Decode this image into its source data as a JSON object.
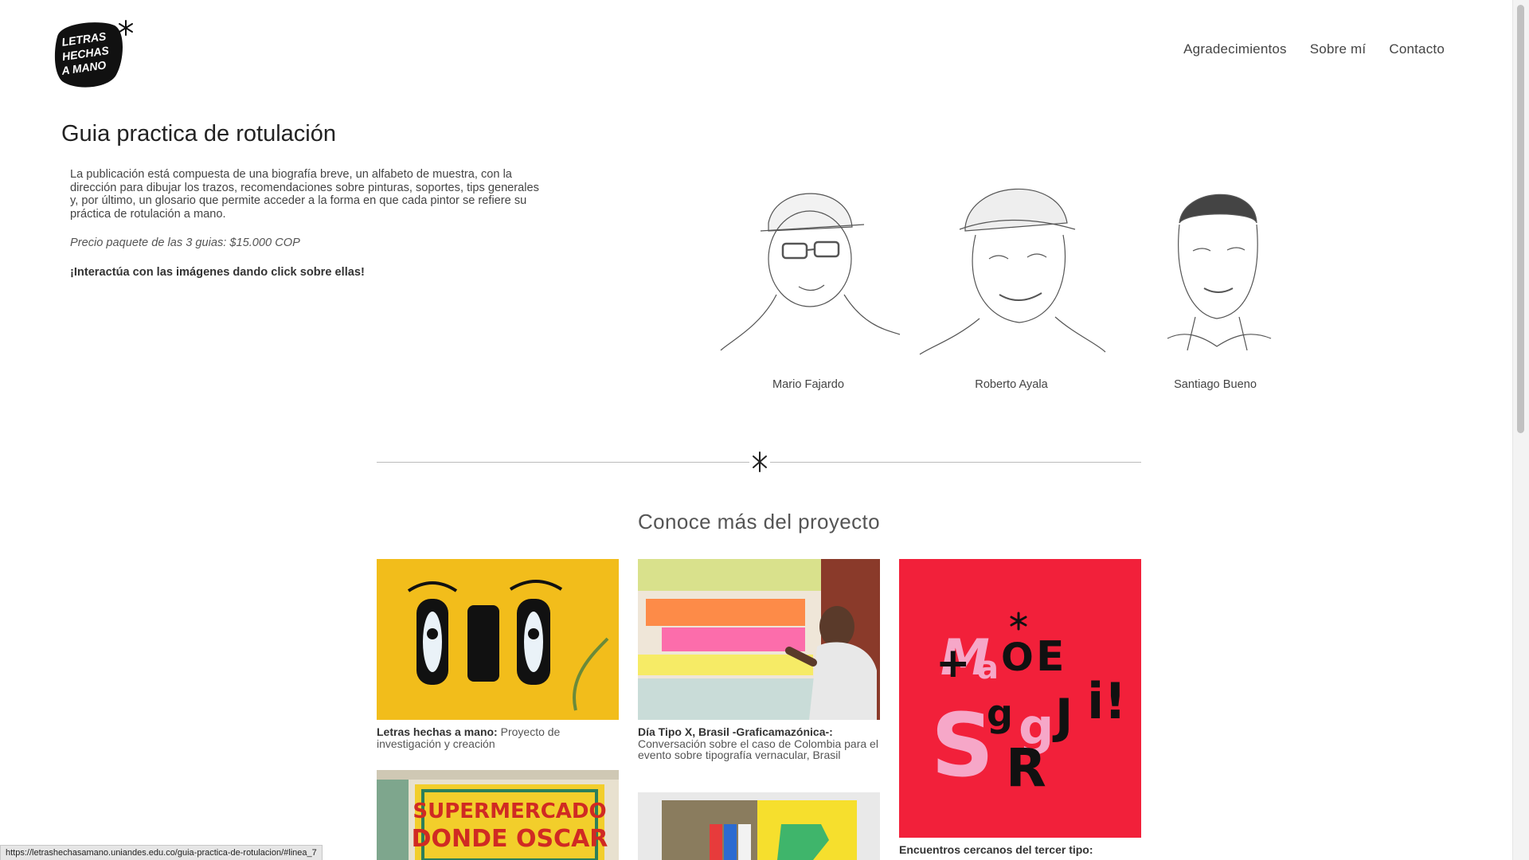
{
  "header": {
    "logo_lines": [
      "LETRAS",
      "HECHAS",
      "A MANO"
    ],
    "nav": [
      "Agradecimientos",
      "Sobre mí",
      "Contacto"
    ]
  },
  "page": {
    "title": "Guia practica de rotulación",
    "description": "La publicación está compuesta de una biografía breve, un alfabeto de muestra, con la dirección para dibujar los trazos, recomendaciones sobre pinturas, soportes, tips generales y, por último, un glosario que permite acceder a la forma en que cada pintor se refiere su práctica de rotulación a mano.",
    "price": "Precio paquete de las 3 guias: $15.000 COP",
    "cta": "¡Interactúa con las imágenes dando click sobre ellas!"
  },
  "portraits": [
    {
      "name": "Mario Fajardo",
      "icon": "portrait-sketch-icon"
    },
    {
      "name": "Roberto Ayala",
      "icon": "portrait-sketch-icon"
    },
    {
      "name": "Santiago Bueno",
      "icon": "portrait-sketch-icon"
    }
  ],
  "section": {
    "title": "Conoce más del proyecto"
  },
  "cards": [
    {
      "title": "Letras hechas a mano:",
      "text": " Proyecto de investigación y creación",
      "image": "ojo-sign"
    },
    {
      "title": "Día Tipo X, Brasil -Graficamazónica-:",
      "text": " Conversación sobre el caso de Colombia para el evento sobre tipografía vernacular, Brasil",
      "image": "mural-painter"
    },
    {
      "title": "Encuentros cercanos del tercer tipo:",
      "text": "",
      "image": "letters-poster"
    },
    {
      "title": "",
      "text": "",
      "image": "supermercado-sign",
      "sign_lines": [
        "SUPERMERCADO",
        "DONDE OSCAR"
      ]
    },
    {
      "title": "",
      "text": "",
      "image": "book-spread"
    }
  ],
  "status_url": "https://letrashechasamano.uniandes.edu.co/guia-practica-de-rotulacion/#linea_7",
  "colors": {
    "accent_red": "#f2203a",
    "sign_yellow": "#f4c21a",
    "pink": "#f6a7c8"
  }
}
